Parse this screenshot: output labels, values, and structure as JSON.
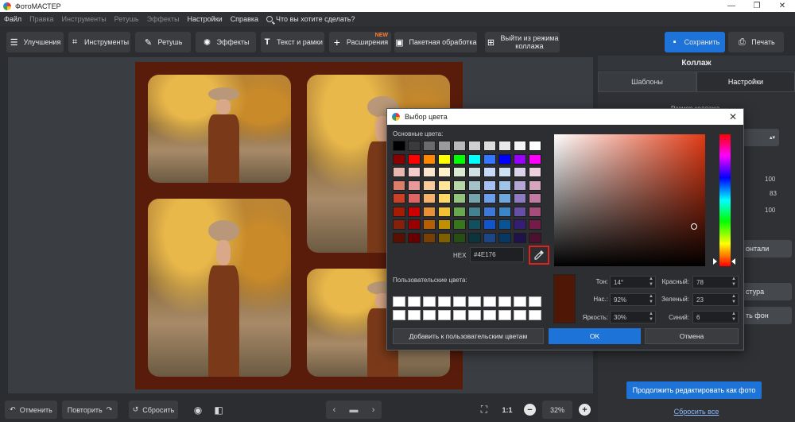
{
  "app": {
    "title": "ФотоМАСТЕР"
  },
  "window_controls": [
    "—",
    "❐",
    "✕"
  ],
  "menu": {
    "items": [
      "Файл",
      "Правка",
      "Инструменты",
      "Ретушь",
      "Эффекты",
      "Настройки",
      "Справка"
    ],
    "dim_items": [
      1,
      2,
      3,
      4
    ],
    "search_placeholder": "Что вы хотите сделать?"
  },
  "toolbar": {
    "improve": "Улучшения",
    "tools": "Инструменты",
    "retouch": "Ретушь",
    "effects": "Эффекты",
    "text": "Текст и рамки",
    "extensions": "Расширения",
    "extensions_badge": "NEW",
    "batch": "Пакетная обработка",
    "exit_collage_line1": "Выйти из режима",
    "exit_collage_line2": "коллажа",
    "save": "Сохранить",
    "print": "Печать"
  },
  "bottombar": {
    "undo": "Отменить",
    "redo": "Повторить",
    "reset": "Сбросить",
    "zoom_fit": "1:1",
    "zoom": "32%"
  },
  "right_panel": {
    "header": "Коллаж",
    "tabs": [
      "Шаблоны",
      "Настройки"
    ],
    "active_tab": 1,
    "ghost_title": "Размер коллажа",
    "values": [
      "100",
      "83",
      "100"
    ],
    "ghost_horizontal": "онтали",
    "ghost_texture": "стура",
    "ghost_bg": "ть фон",
    "continue": "Продолжить редактировать как фото",
    "reset_all": "Сбросить все"
  },
  "color_dialog": {
    "title": "Выбор цвета",
    "basic_colors_label": "Основные цвета:",
    "custom_colors_label": "Пользовательские цвета:",
    "hex_label": "HEX",
    "hex_value": "#4E176",
    "preview_color": "#4e1706",
    "hue_label": "Тон:",
    "hue_value": "14°",
    "sat_label": "Нас.:",
    "sat_value": "92%",
    "bright_label": "Яркость:",
    "bright_value": "30%",
    "red_label": "Красный:",
    "red_value": "78",
    "green_label": "Зеленый:",
    "green_value": "23",
    "blue_label": "Синий:",
    "blue_value": "6",
    "add_custom": "Добавить к пользовательским цветам",
    "ok": "OK",
    "cancel": "Отмена",
    "basic_colors": [
      "#000000",
      "#3a3a3a",
      "#6a6a6a",
      "#9a9a9a",
      "#b8b8b8",
      "#cfcfcf",
      "#dcdcdc",
      "#e8e8e8",
      "#f4f4f4",
      "#ffffff",
      "#8a0000",
      "#ff0000",
      "#ff8800",
      "#ffff00",
      "#00ff00",
      "#00ffff",
      "#3377ff",
      "#0000ff",
      "#9900ff",
      "#ff00ff",
      "#e6b8b0",
      "#f4cccc",
      "#fce5cd",
      "#fff2cc",
      "#d9ead3",
      "#d0e0e3",
      "#c9daf8",
      "#cfe2f3",
      "#d9d2e9",
      "#ead1dc",
      "#dd7e6b",
      "#ea9999",
      "#f9cb9c",
      "#ffe599",
      "#b6d7a8",
      "#a2c4c9",
      "#a4c2f4",
      "#9fc5e8",
      "#b4a7d6",
      "#d5a6bd",
      "#cc4125",
      "#e06666",
      "#f6b26b",
      "#ffd966",
      "#93c47d",
      "#76a5af",
      "#6d9eeb",
      "#6fa8dc",
      "#8e7cc3",
      "#c27ba0",
      "#a61c00",
      "#cc0000",
      "#e69138",
      "#f1c232",
      "#6aa84f",
      "#45818e",
      "#3c78d8",
      "#3d85c6",
      "#674ea7",
      "#a64d79",
      "#85200c",
      "#990000",
      "#b45f06",
      "#bf9000",
      "#38761d",
      "#134f5c",
      "#1155cc",
      "#0b5394",
      "#351c75",
      "#741b47",
      "#5b0f00",
      "#660000",
      "#783f04",
      "#7f6000",
      "#274e13",
      "#0c343d",
      "#1c4587",
      "#073763",
      "#20124d",
      "#4c1130"
    ],
    "custom_count": 20
  }
}
